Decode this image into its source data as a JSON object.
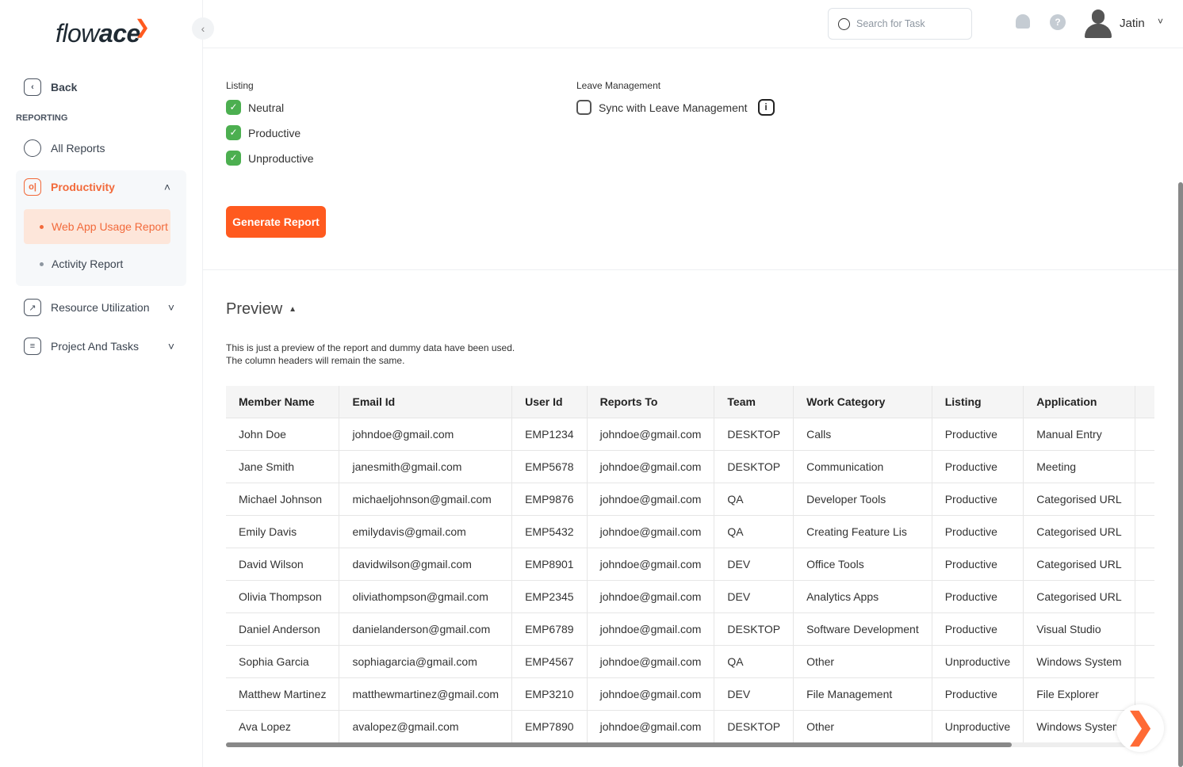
{
  "brand": {
    "logo": "flowace"
  },
  "sidebar": {
    "back": "Back",
    "section": "REPORTING",
    "all_reports": "All Reports",
    "productivity": "Productivity",
    "sub_items": [
      "Web App Usage Report",
      "Activity Report"
    ],
    "resource": "Resource Utilization",
    "project": "Project And Tasks"
  },
  "topbar": {
    "search_placeholder": "Search for Task",
    "help": "?",
    "user": "Jatin"
  },
  "form": {
    "listing_label": "Listing",
    "listing_options": [
      {
        "label": "Neutral",
        "checked": true
      },
      {
        "label": "Productive",
        "checked": true
      },
      {
        "label": "Unproductive",
        "checked": true
      }
    ],
    "leave_label": "Leave Management",
    "leave_option": {
      "label": "Sync with Leave Management",
      "checked": false
    },
    "generate": "Generate Report"
  },
  "preview": {
    "title": "Preview",
    "note1": "This is just a preview of the report and dummy data have been used.",
    "note2": "The column headers will remain the same."
  },
  "table": {
    "headers": [
      "Member Name",
      "Email Id",
      "User Id",
      "Reports To",
      "Team",
      "Work Category",
      "Listing",
      "Application",
      ""
    ],
    "rows": [
      [
        "John Doe",
        "johndoe@gmail.com",
        "EMP1234",
        "johndoe@gmail.com",
        "DESKTOP",
        "Calls",
        "Productive",
        "Manual Entry"
      ],
      [
        "Jane Smith",
        "janesmith@gmail.com",
        "EMP5678",
        "johndoe@gmail.com",
        "DESKTOP",
        "Communication",
        "Productive",
        "Meeting"
      ],
      [
        "Michael Johnson",
        "michaeljohnson@gmail.com",
        "EMP9876",
        "johndoe@gmail.com",
        "QA",
        "Developer Tools",
        "Productive",
        "Categorised URL"
      ],
      [
        "Emily Davis",
        "emilydavis@gmail.com",
        "EMP5432",
        "johndoe@gmail.com",
        "QA",
        "Creating Feature Lis",
        "Productive",
        "Categorised URL"
      ],
      [
        "David Wilson",
        "davidwilson@gmail.com",
        "EMP8901",
        "johndoe@gmail.com",
        "DEV",
        "Office Tools",
        "Productive",
        "Categorised URL"
      ],
      [
        "Olivia Thompson",
        "oliviathompson@gmail.com",
        "EMP2345",
        "johndoe@gmail.com",
        "DEV",
        "Analytics Apps",
        "Productive",
        "Categorised URL"
      ],
      [
        "Daniel Anderson",
        "danielanderson@gmail.com",
        "EMP6789",
        "johndoe@gmail.com",
        "DESKTOP",
        "Software Development",
        "Productive",
        "Visual Studio"
      ],
      [
        "Sophia Garcia",
        "sophiagarcia@gmail.com",
        "EMP4567",
        "johndoe@gmail.com",
        "QA",
        "Other",
        "Unproductive",
        "Windows System"
      ],
      [
        "Matthew Martinez",
        "matthewmartinez@gmail.com",
        "EMP3210",
        "johndoe@gmail.com",
        "DEV",
        "File Management",
        "Productive",
        "File Explorer"
      ],
      [
        "Ava Lopez",
        "avalopez@gmail.com",
        "EMP7890",
        "johndoe@gmail.com",
        "DESKTOP",
        "Other",
        "Unproductive",
        "Windows System"
      ]
    ]
  },
  "colors": {
    "accent": "#ff5a1f",
    "active_bg": "#fde6da",
    "check": "#4caf50"
  }
}
